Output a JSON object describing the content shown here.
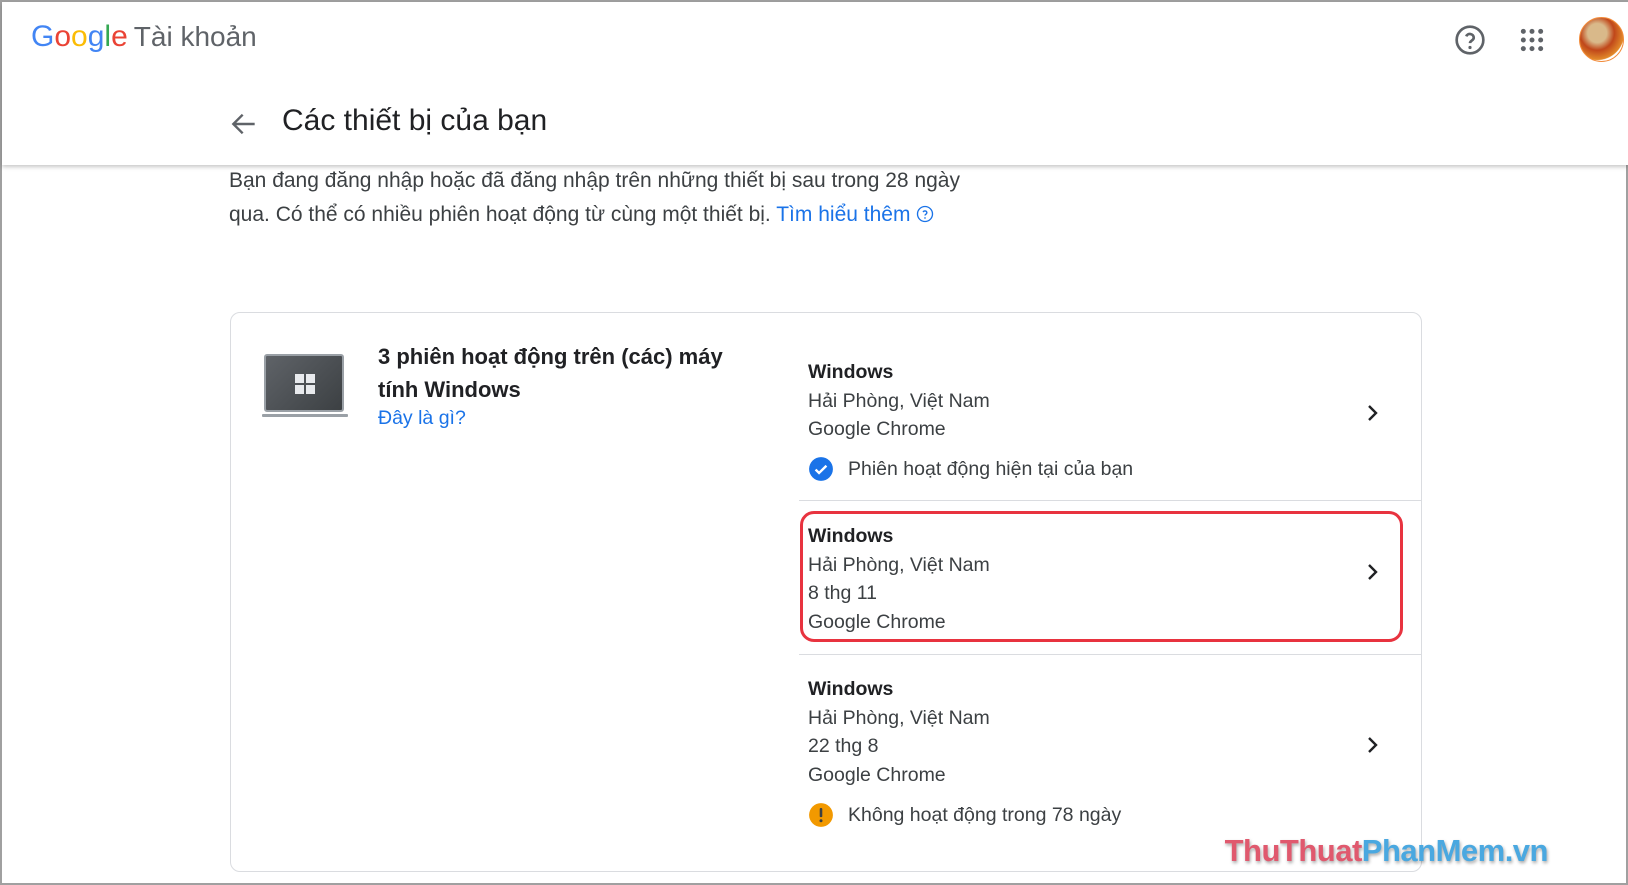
{
  "header": {
    "logo": {
      "G": "G",
      "o1": "o",
      "o2": "o",
      "g": "g",
      "l": "l",
      "e": "e"
    },
    "product": "Tài khoản",
    "help_icon": "help-circle-icon",
    "apps_icon": "apps-grid-icon",
    "avatar_icon": "avatar"
  },
  "page": {
    "title": "Các thiết bị của bạn",
    "intro": "Bạn đang đăng nhập hoặc đã đăng nhập trên những thiết bị sau trong 28 ngày qua. Có thể có nhiều phiên hoạt động từ cùng một thiết bị.",
    "learn_more": "Tìm hiểu thêm"
  },
  "device_group": {
    "heading": "3 phiên hoạt động trên (các) máy tính Windows",
    "what_link": "Đây là gì?",
    "sessions": [
      {
        "os": "Windows",
        "location": "Hải Phòng, Việt Nam",
        "browser": "Google Chrome",
        "status": "Phiên hoạt động hiện tại của bạn"
      },
      {
        "os": "Windows",
        "location": "Hải Phòng, Việt Nam",
        "date": "8 thg 11",
        "browser": "Google Chrome"
      },
      {
        "os": "Windows",
        "location": "Hải Phòng, Việt Nam",
        "date": "22 thg 8",
        "browser": "Google Chrome",
        "status": "Không hoạt động trong 78 ngày"
      }
    ]
  },
  "watermark": {
    "part1": "ThuThuat",
    "part2": "PhanMem.vn"
  },
  "colors": {
    "accent": "#1a73e8",
    "highlight": "#e8333f",
    "warning": "#f29900"
  }
}
